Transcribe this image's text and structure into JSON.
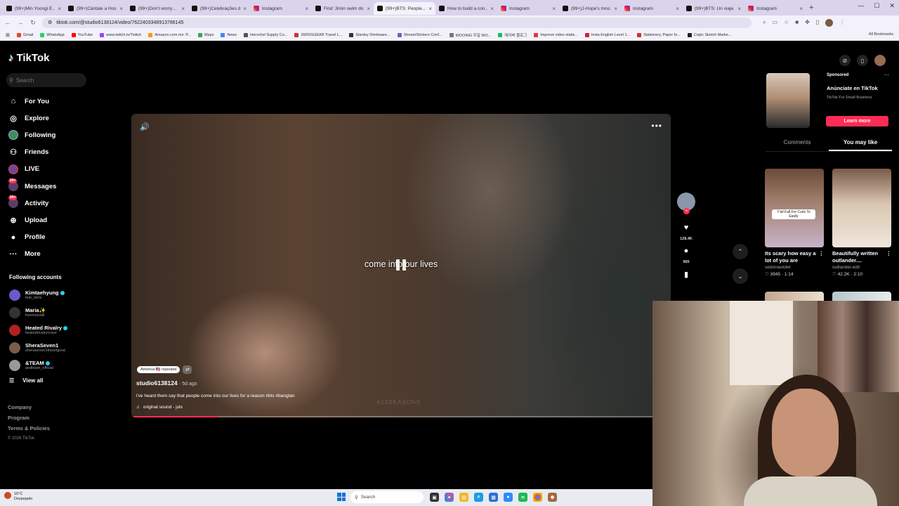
{
  "browser": {
    "tabs": [
      {
        "label": "(99+)Min Yoongi E...",
        "favicon": "tiktok"
      },
      {
        "label": "(99+)Cántale a Hos...",
        "favicon": "tiktok"
      },
      {
        "label": "(99+)Don't worry...",
        "favicon": "tiktok"
      },
      {
        "label": "(99+)Celebrações d...",
        "favicon": "tiktok"
      },
      {
        "label": "Instagram",
        "favicon": "instagram"
      },
      {
        "label": "Find 'Jimin swim do...",
        "favicon": "tiktok"
      },
      {
        "label": "(99+)BTS: People...",
        "favicon": "tiktok",
        "active": true
      },
      {
        "label": "How to build a con...",
        "favicon": "tiktok"
      },
      {
        "label": "Instagram",
        "favicon": "instagram"
      },
      {
        "label": "(99+)J-Hope's Inno...",
        "favicon": "tiktok"
      },
      {
        "label": "Instagram",
        "favicon": "instagram"
      },
      {
        "label": "(99+)BTS: Un viaje...",
        "favicon": "tiktok"
      },
      {
        "label": "Instagram",
        "favicon": "instagram"
      }
    ],
    "url": "tiktok.com/@studio6138124/video/7622403348913786145",
    "bookmarks": [
      {
        "label": "Gmail",
        "color": "#ea4335"
      },
      {
        "label": "WhatsApp",
        "color": "#25d366"
      },
      {
        "label": "YouTube",
        "color": "#ff0000"
      },
      {
        "label": "www.twitch.tv/Twitch",
        "color": "#9146ff"
      },
      {
        "label": "Amazon.com.mx: P...",
        "color": "#f90"
      },
      {
        "label": "Maps",
        "color": "#34a853"
      },
      {
        "label": "News",
        "color": "#4285f4"
      },
      {
        "label": "Herschel Supply Co...",
        "color": "#555"
      },
      {
        "label": "SWISSGEAR Travel L...",
        "color": "#d32f2f"
      },
      {
        "label": "Stanley Drinkware...",
        "color": "#333"
      },
      {
        "label": "StreamStickers Conf...",
        "color": "#7e57c2"
      },
      {
        "label": "WOOING 우일 WO...",
        "color": "#777"
      },
      {
        "label": "데이버 블로그",
        "color": "#03c75a"
      },
      {
        "label": "Improve video statis...",
        "color": "#e53935"
      },
      {
        "label": "Insta English Level 1...",
        "color": "#c62828"
      },
      {
        "label": "Stationery, Paper fo...",
        "color": "#d32f2f"
      },
      {
        "label": "Copic Sketch Marke...",
        "color": "#222"
      }
    ],
    "all_bookmarks": "All Bookmarks"
  },
  "tiktok": {
    "brand": "TikTok",
    "search_placeholder": "Search",
    "nav": [
      {
        "label": "For You",
        "icon": "home-icon"
      },
      {
        "label": "Explore",
        "icon": "compass-icon"
      },
      {
        "label": "Following",
        "icon": "following-icon"
      },
      {
        "label": "Friends",
        "icon": "friends-icon"
      },
      {
        "label": "LIVE",
        "icon": "live-icon"
      },
      {
        "label": "Messages",
        "icon": "messages-icon",
        "badge": "99+"
      },
      {
        "label": "Activity",
        "icon": "activity-icon",
        "badge": "99+"
      },
      {
        "label": "Upload",
        "icon": "upload-icon"
      },
      {
        "label": "Profile",
        "icon": "profile-icon"
      },
      {
        "label": "More",
        "icon": "more-icon"
      }
    ],
    "following_title": "Following accounts",
    "following": [
      {
        "name": "Kimtaehyung",
        "handle": "tete_kimv",
        "verified": true,
        "color": "#6a5acd"
      },
      {
        "name": "Maria✨",
        "handle": "freelovestill",
        "verified": false,
        "color": "#333"
      },
      {
        "name": "Heated Rivalry",
        "handle": "heatedrivalrycrave",
        "verified": true,
        "color": "#b22222"
      },
      {
        "name": "SheraSeven1",
        "handle": "sheraseven1theoriginal",
        "verified": false,
        "color": "#7a5c4a"
      },
      {
        "name": "&TEAM",
        "handle": "andteam_official",
        "verified": true,
        "color": "#999"
      }
    ],
    "view_all": "View all",
    "footer": {
      "company": "Company",
      "program": "Program",
      "terms": "Terms & Policies",
      "copyright": "© 2026 TikTok"
    },
    "video": {
      "caption": "come into our lives",
      "reposted": "America 🇺🇸 reposted",
      "author": "studio6138124",
      "ago": "5d ago",
      "description": "i've heard them say that people come into our lives for a reason #bts #bangtan",
      "sound": "original sound - juls",
      "watermark": "613SEASONS",
      "progress": 0.16
    },
    "actions": {
      "likes": "128.4K",
      "comments": "965"
    },
    "ad": {
      "sponsored": "Sponsored",
      "title": "Anúnciate en TikTok",
      "subtitle": "TikTok For Small Business",
      "cta": "Learn more"
    },
    "panel_tabs": {
      "comments": "Comments",
      "you_may_like": "You may like"
    },
    "suggestions": [
      {
        "title": "Its scary how easy a lot of you are",
        "user": "sedonaviolet",
        "stats": "♡ 3945 · 1:14",
        "overlay": "Y'all Fall For Curls To Easily"
      },
      {
        "title": "Beautifully written outlander....",
        "user": "outlander.edit",
        "stats": "♡ 42.2K · 2:10",
        "overlay": ""
      }
    ]
  },
  "taskbar": {
    "temp": "16°C",
    "weather": "Despejado",
    "search": "Search"
  }
}
